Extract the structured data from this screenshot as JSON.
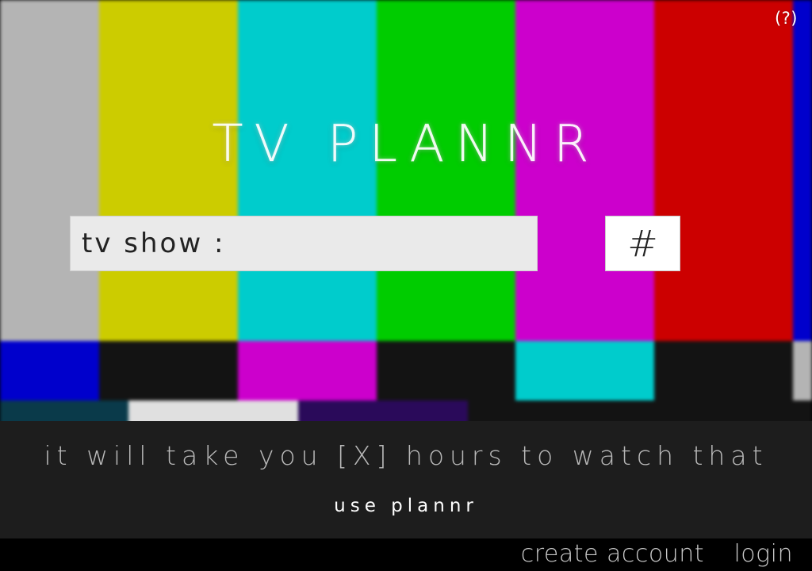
{
  "header": {
    "help_label": "(?)"
  },
  "title": "TV PLANNR",
  "search": {
    "placeholder": "tv show :",
    "value": "",
    "submit_label": "#"
  },
  "info": {
    "result_text": "it will take you [X] hours to watch that",
    "tagline": "use plannr"
  },
  "footer": {
    "create_account": "create account",
    "login": "login"
  },
  "colors": {
    "info_panel_bg": "#1d1d1d",
    "footer_bg": "#000000",
    "input_bg": "#eaeaea",
    "button_bg": "#ffffff"
  },
  "background_bars": {
    "top": [
      "#b4b4b4",
      "#cccc00",
      "#00cccc",
      "#00cc00",
      "#cc00cc",
      "#cc0000",
      "#0000cc"
    ],
    "middle": [
      "#0000cc",
      "#131313",
      "#cc00cc",
      "#131313",
      "#00cccc",
      "#131313",
      "#b4b4b4"
    ],
    "bottom": [
      "#0a3a4a",
      "#e0e0e0",
      "#2a0a5a",
      "#131313",
      "#131313",
      "#131313"
    ]
  }
}
